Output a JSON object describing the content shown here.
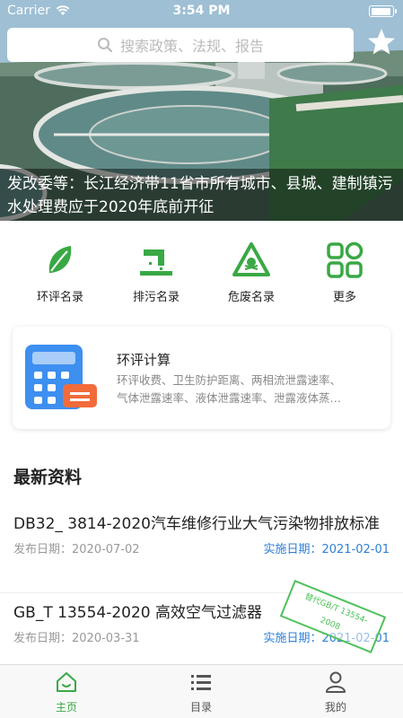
{
  "status_bar": {
    "carrier": "Carrier",
    "time": "3:54 PM",
    "battery_level": 0.95
  },
  "search": {
    "placeholder": "搜索政策、法规、报告"
  },
  "hero": {
    "caption": "发改委等：长江经济带11省市所有城市、县城、建制镇污水处理费应于2020年底前开征"
  },
  "categories": [
    {
      "label": "环评名录",
      "icon": "leaf-icon"
    },
    {
      "label": "排污名录",
      "icon": "discharge-pipe-icon"
    },
    {
      "label": "危废名录",
      "icon": "hazard-skull-icon"
    },
    {
      "label": "更多",
      "icon": "grid-more-icon"
    }
  ],
  "calculator": {
    "title": "环评计算",
    "desc_line1": "环评收费、卫生防护距离、两相流泄露速率、",
    "desc_line2": "气体泄露速率、液体泄露速率、泄露液体蒸…",
    "icon": "calculator-icon"
  },
  "latest": {
    "title": "最新资料",
    "items": [
      {
        "title": "DB32_ 3814-2020汽车维修行业大气污染物排放标准",
        "publish": "发布日期：2020-07-02",
        "effective": "实施日期：2021-02-01"
      },
      {
        "title": "GB_T 13554-2020 高效空气过滤器",
        "publish": "发布日期：2020-03-31",
        "effective": "实施日期：2021-02-01",
        "stamp_line1": "替代GB/T 13554-",
        "stamp_line2": "2008"
      }
    ]
  },
  "tabbar": [
    {
      "label": "主页",
      "icon": "home-icon",
      "active": true
    },
    {
      "label": "目录",
      "icon": "list-icon",
      "active": false
    },
    {
      "label": "我的",
      "icon": "user-icon",
      "active": false
    }
  ],
  "colors": {
    "accent_green": "#3aa845",
    "link_blue": "#2e7fd6",
    "calc_blue": "#3d8ff0",
    "calc_orange": "#f26b3a"
  }
}
